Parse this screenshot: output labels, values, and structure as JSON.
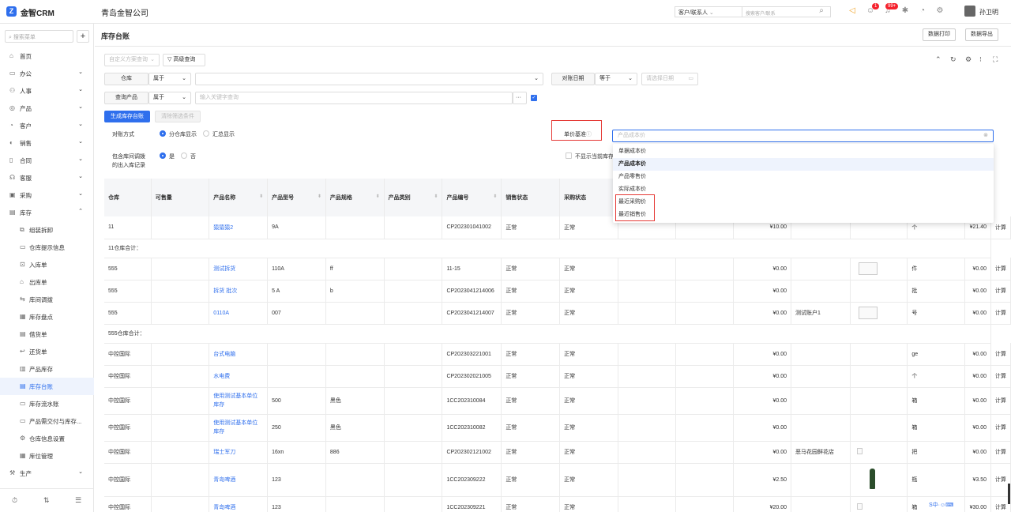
{
  "app": {
    "logo_letter": "Z",
    "name": "金智CRM",
    "company": "青岛金智公司"
  },
  "topbar": {
    "search_type": "客户/联系人",
    "search_placeholder": "搜索客户/联系",
    "badge_1": "1",
    "badge_2": "99+",
    "user": "孙卫明"
  },
  "sidebar": {
    "search_placeholder": "搜索菜单",
    "add": "+",
    "items": [
      {
        "label": "首页",
        "icon": "⌂",
        "chev": ""
      },
      {
        "label": "办公",
        "icon": "▭",
        "chev": "⌄"
      },
      {
        "label": "人事",
        "icon": "⚇",
        "chev": "⌄"
      },
      {
        "label": "产品",
        "icon": "◎",
        "chev": "⌄"
      },
      {
        "label": "客户",
        "icon": "◔",
        "chev": "⌄"
      },
      {
        "label": "销售",
        "icon": "◐",
        "chev": "⌄"
      },
      {
        "label": "合同",
        "icon": "▯",
        "chev": "⌄"
      },
      {
        "label": "客服",
        "icon": "☊",
        "chev": "⌄"
      },
      {
        "label": "采购",
        "icon": "▣",
        "chev": "⌄"
      },
      {
        "label": "库存",
        "icon": "▤",
        "chev": "⌃"
      }
    ],
    "sub_items": [
      {
        "label": "组装拆卸",
        "icon": "⧉"
      },
      {
        "label": "仓库提示信息",
        "icon": "▭"
      },
      {
        "label": "入库单",
        "icon": "⊡"
      },
      {
        "label": "出库单",
        "icon": "⌂"
      },
      {
        "label": "库间调拨",
        "icon": "⇆"
      },
      {
        "label": "库存盘点",
        "icon": "▦"
      },
      {
        "label": "借货单",
        "icon": "▤"
      },
      {
        "label": "还货单",
        "icon": "↩"
      },
      {
        "label": "产品库存",
        "icon": "▥"
      },
      {
        "label": "库存台账",
        "icon": "▤"
      },
      {
        "label": "库存流水账",
        "icon": "▭"
      },
      {
        "label": "产品需交付与库存...",
        "icon": "▭"
      },
      {
        "label": "仓库信息设置",
        "icon": "⚙"
      },
      {
        "label": "库位管理",
        "icon": "▦"
      }
    ],
    "after_items": [
      {
        "label": "生产",
        "icon": "⚒",
        "chev": "⌄"
      }
    ],
    "footer": [
      "⏱",
      "⇅",
      "☰"
    ]
  },
  "header": {
    "title": "库存台账",
    "print": "数据打印",
    "export": "数据导出"
  },
  "filters": {
    "custom_scheme": "自定义方案查询",
    "advanced": "高级查询",
    "warehouse_label": "仓库",
    "warehouse_op": "属于",
    "date_label": "对账日期",
    "date_op": "等于",
    "date_placeholder": "请选择日期",
    "product_label": "查询产品",
    "product_op": "属于",
    "product_placeholder": "输入关键字查询",
    "dots": "···",
    "generate": "生成库存台账",
    "clear": "清除筛选条件",
    "recon_label": "对账方式",
    "recon_opt1": "分仓库显示",
    "recon_opt2": "汇总显示",
    "transfer_label_1": "包含库间调拨",
    "transfer_label_2": "的出入库记录",
    "yes": "是",
    "no": "否",
    "price_basis_label": "单价基准",
    "no_show_current": "不显示当前库存"
  },
  "dropdown": {
    "placeholder": "产品成本价",
    "options": [
      "单据成本价",
      "产品成本价",
      "产品零售价",
      "实际成本价",
      "最近采购价",
      "最近销售价"
    ],
    "selected_index": 1
  },
  "table": {
    "columns": [
      "仓库",
      "可售量",
      "产品名称",
      "产品型号",
      "产品规格",
      "产品类别",
      "产品编号",
      "销售状态",
      "采购状态"
    ],
    "right_head": "计算",
    "rows": [
      {
        "type": "data",
        "c": [
          "11",
          "",
          "猿猿猿2",
          "9A",
          "",
          "",
          "CP202301041002",
          "正常",
          "正常"
        ],
        "amount": "¥10.00",
        "customer": "",
        "unit": "个",
        "total": "¥21.40",
        "tail": "计算"
      },
      {
        "type": "sum",
        "label": "11仓库合计："
      },
      {
        "type": "data",
        "c": [
          "555",
          "",
          "测试拆货",
          "110A",
          "ff",
          "",
          "11-15",
          "正常",
          "正常"
        ],
        "amount": "¥0.00",
        "customer": "",
        "unit": "件",
        "total": "¥0.00",
        "tail": "计算",
        "img": "doc"
      },
      {
        "type": "data",
        "c": [
          "555",
          "",
          "拆货 批次",
          "5 A",
          "b",
          "",
          "CP2023041214006",
          "正常",
          "正常"
        ],
        "amount": "¥0.00",
        "customer": "",
        "unit": "批",
        "total": "¥0.00",
        "tail": "计算"
      },
      {
        "type": "data",
        "c": [
          "555",
          "",
          "0110A",
          "007",
          "",
          "",
          "CP2023041214007",
          "正常",
          "正常"
        ],
        "amount": "¥0.00",
        "customer": "测试账户1",
        "unit": "号",
        "total": "¥0.00",
        "tail": "计算",
        "img": "doc"
      },
      {
        "type": "sum",
        "label": "555仓库合计："
      },
      {
        "type": "data",
        "c": [
          "中控国际",
          "",
          "台式电脑",
          "",
          "",
          "",
          "CP202303221001",
          "正常",
          "正常"
        ],
        "amount": "¥0.00",
        "customer": "",
        "unit": "ge",
        "total": "¥0.00",
        "tail": "计算"
      },
      {
        "type": "data",
        "c": [
          "中控国际",
          "",
          "水电费",
          "",
          "",
          "",
          "CP202302021005",
          "正常",
          "正常"
        ],
        "amount": "¥0.00",
        "customer": "",
        "unit": "个",
        "total": "¥0.00",
        "tail": "计算"
      },
      {
        "type": "data2",
        "c": [
          "中控国际",
          "",
          "使用测试基本单位库",
          "500",
          "黑色",
          "",
          "1CC202310084",
          "正常",
          "正常"
        ],
        "name2": "存",
        "amount": "¥0.00",
        "customer": "",
        "unit": "箱",
        "total": "¥0.00",
        "tail": "计算"
      },
      {
        "type": "data2",
        "c": [
          "中控国际",
          "",
          "使用测试基本单位库",
          "250",
          "黑色",
          "",
          "1CC202310082",
          "正常",
          "正常"
        ],
        "name2": "存",
        "amount": "¥0.00",
        "customer": "",
        "unit": "箱",
        "total": "¥0.00",
        "tail": "计算"
      },
      {
        "type": "data",
        "c": [
          "中控国际",
          "",
          "瑞士军刀",
          "16xn",
          "886",
          "",
          "CP202302121002",
          "正常",
          "正常"
        ],
        "amount": "¥0.00",
        "customer": "恶马花园鲜花店",
        "unit": "把",
        "total": "¥0.00",
        "tail": "计算",
        "img": "broken"
      },
      {
        "type": "data",
        "c": [
          "中控国际",
          "",
          "青岛啤酒",
          "123",
          "",
          "",
          "1CC202309222",
          "正常",
          "正常"
        ],
        "amount": "¥2.50",
        "customer": "",
        "unit": "瓶",
        "total": "¥3.50",
        "tail": "计算",
        "img": "bottle"
      },
      {
        "type": "data",
        "c": [
          "中控国际",
          "",
          "青岛啤酒",
          "123",
          "",
          "",
          "1CC202309221",
          "正常",
          "正常"
        ],
        "amount": "¥20.00",
        "customer": "",
        "unit": "箱",
        "total": "¥30.00",
        "tail": "计算",
        "img": "broken"
      }
    ]
  },
  "tray": "S中·☺⌨",
  "colors": {
    "accent": "#2f6fed",
    "highlight": "#e53935"
  }
}
